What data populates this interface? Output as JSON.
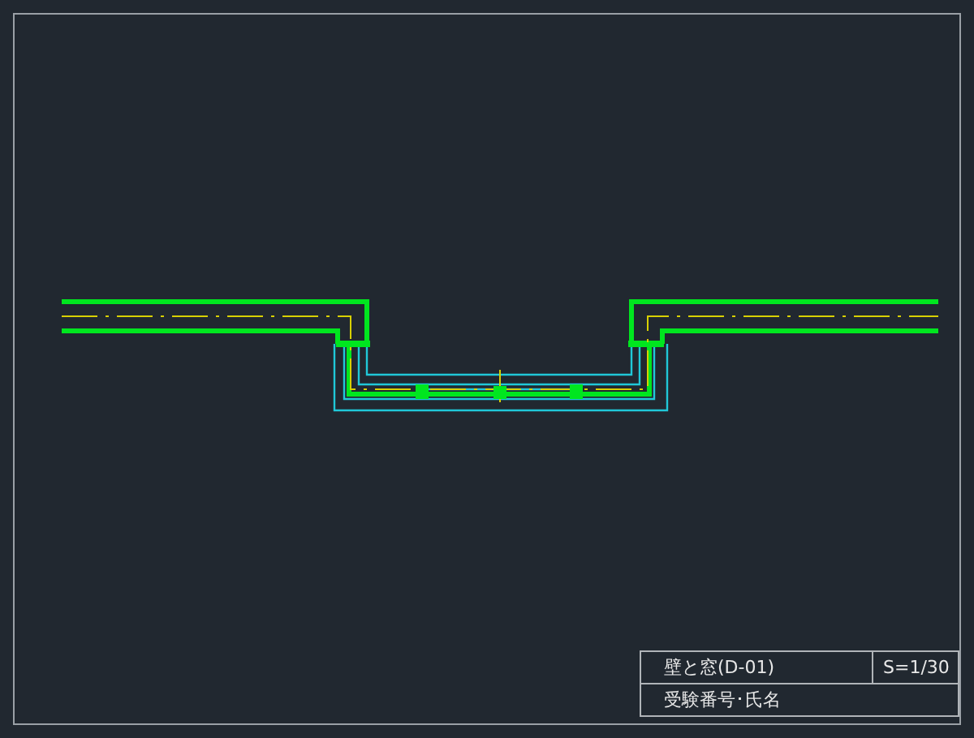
{
  "title_block": {
    "title": "壁と窓(D-01)",
    "scale": "S=1/30",
    "candidate_label": "受験番号･氏名"
  }
}
